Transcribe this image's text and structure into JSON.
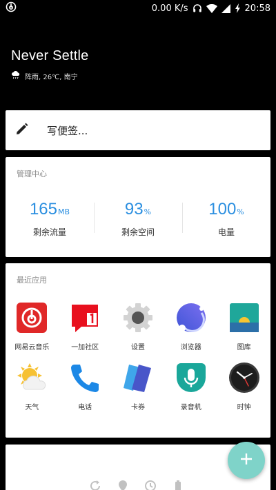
{
  "status_bar": {
    "network_speed": "0.00 K/s",
    "time": "20:58"
  },
  "header": {
    "motto": "Never Settle",
    "weather": "阵雨, 26℃, 南宁"
  },
  "note_card": {
    "label": "写便签..."
  },
  "management": {
    "title": "管理中心",
    "stats": [
      {
        "value": "165",
        "unit": "MB",
        "label": "剩余流量"
      },
      {
        "value": "93",
        "unit": "%",
        "label": "剩余空间"
      },
      {
        "value": "100",
        "unit": "%",
        "label": "电量"
      }
    ]
  },
  "recent_apps": {
    "title": "最近应用",
    "apps": [
      {
        "label": "网易云音乐",
        "icon": "netease-music-icon"
      },
      {
        "label": "一加社区",
        "icon": "oneplus-community-icon"
      },
      {
        "label": "设置",
        "icon": "settings-gear-icon"
      },
      {
        "label": "浏览器",
        "icon": "browser-icon"
      },
      {
        "label": "图库",
        "icon": "gallery-icon"
      },
      {
        "label": "天气",
        "icon": "weather-icon"
      },
      {
        "label": "电话",
        "icon": "phone-icon"
      },
      {
        "label": "卡券",
        "icon": "cards-icon"
      },
      {
        "label": "录音机",
        "icon": "recorder-icon"
      },
      {
        "label": "时钟",
        "icon": "clock-icon"
      }
    ]
  },
  "colors": {
    "accent_blue": "#2b8fe0",
    "fab": "#7fd3c9"
  }
}
